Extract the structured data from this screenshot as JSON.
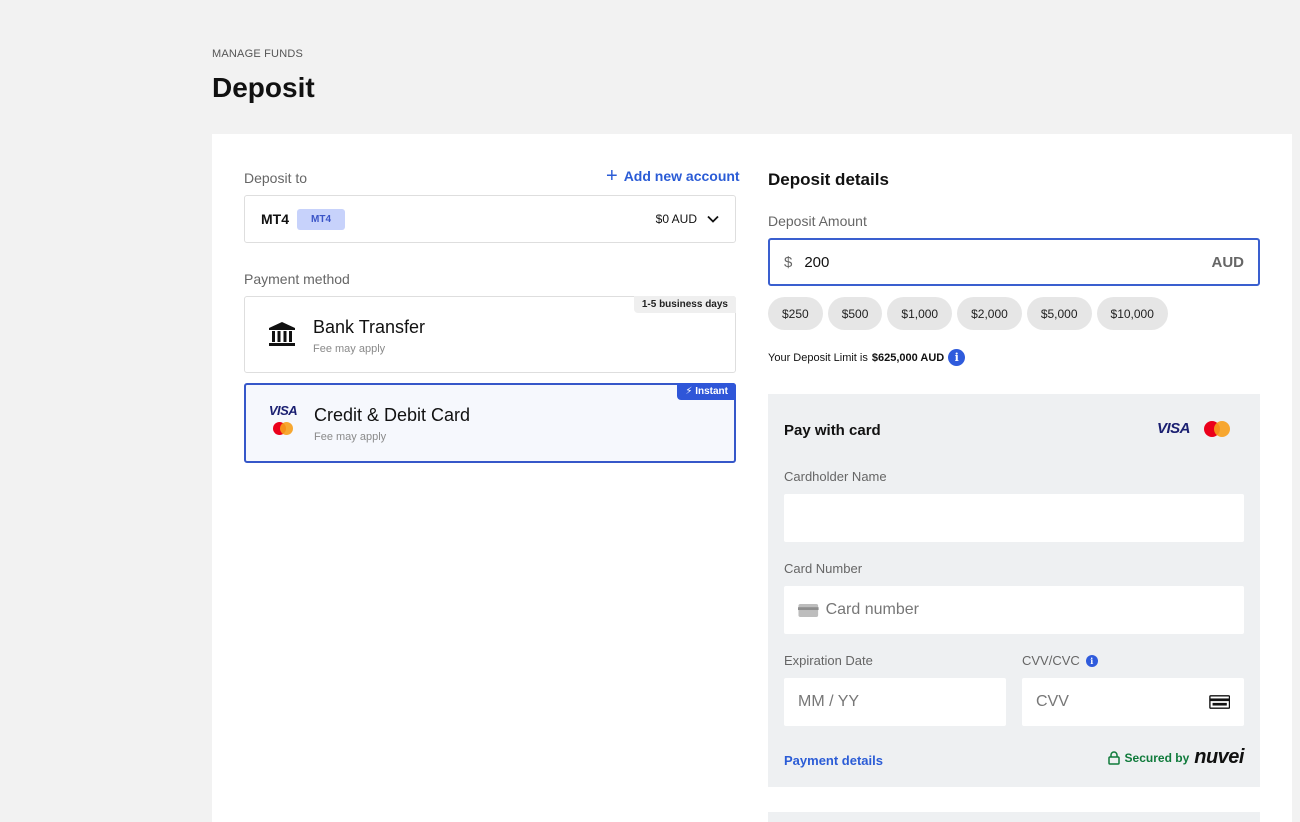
{
  "header": {
    "eyebrow": "MANAGE FUNDS",
    "title": "Deposit"
  },
  "deposit_to": {
    "label": "Deposit to",
    "add_account": "Add new account",
    "account_name": "MT4",
    "account_tag": "MT4",
    "balance": "$0 AUD"
  },
  "payment": {
    "label": "Payment method",
    "methods": [
      {
        "title": "Bank Transfer",
        "subtitle": "Fee may apply",
        "badge": "1-5 business days",
        "selected": false
      },
      {
        "title": "Credit & Debit Card",
        "subtitle": "Fee may apply",
        "badge": "Instant",
        "selected": true,
        "logo_text": "VISA"
      }
    ]
  },
  "details": {
    "title": "Deposit details",
    "amount_label": "Deposit Amount",
    "currency_symbol": "$",
    "amount_value": "200",
    "currency_code": "AUD",
    "quick_amounts": [
      "$250",
      "$500",
      "$1,000",
      "$2,000",
      "$5,000",
      "$10,000"
    ],
    "limit_prefix": "Your Deposit Limit is",
    "limit_value": "$625,000 AUD",
    "info_glyph": "i"
  },
  "card_form": {
    "title": "Pay with card",
    "visa_logo": "VISA",
    "cardholder_label": "Cardholder Name",
    "card_number_label": "Card Number",
    "card_number_placeholder": "Card number",
    "expiry_label": "Expiration Date",
    "expiry_placeholder": "MM / YY",
    "cvv_label": "CVV/CVC",
    "cvv_placeholder": "CVV",
    "payment_details_link": "Payment details",
    "secured_by": "Secured by",
    "provider": "nuvei"
  },
  "colors": {
    "accent": "#2b5cd6",
    "selected_border": "#3657c9",
    "secured_green": "#0f7a3b"
  }
}
